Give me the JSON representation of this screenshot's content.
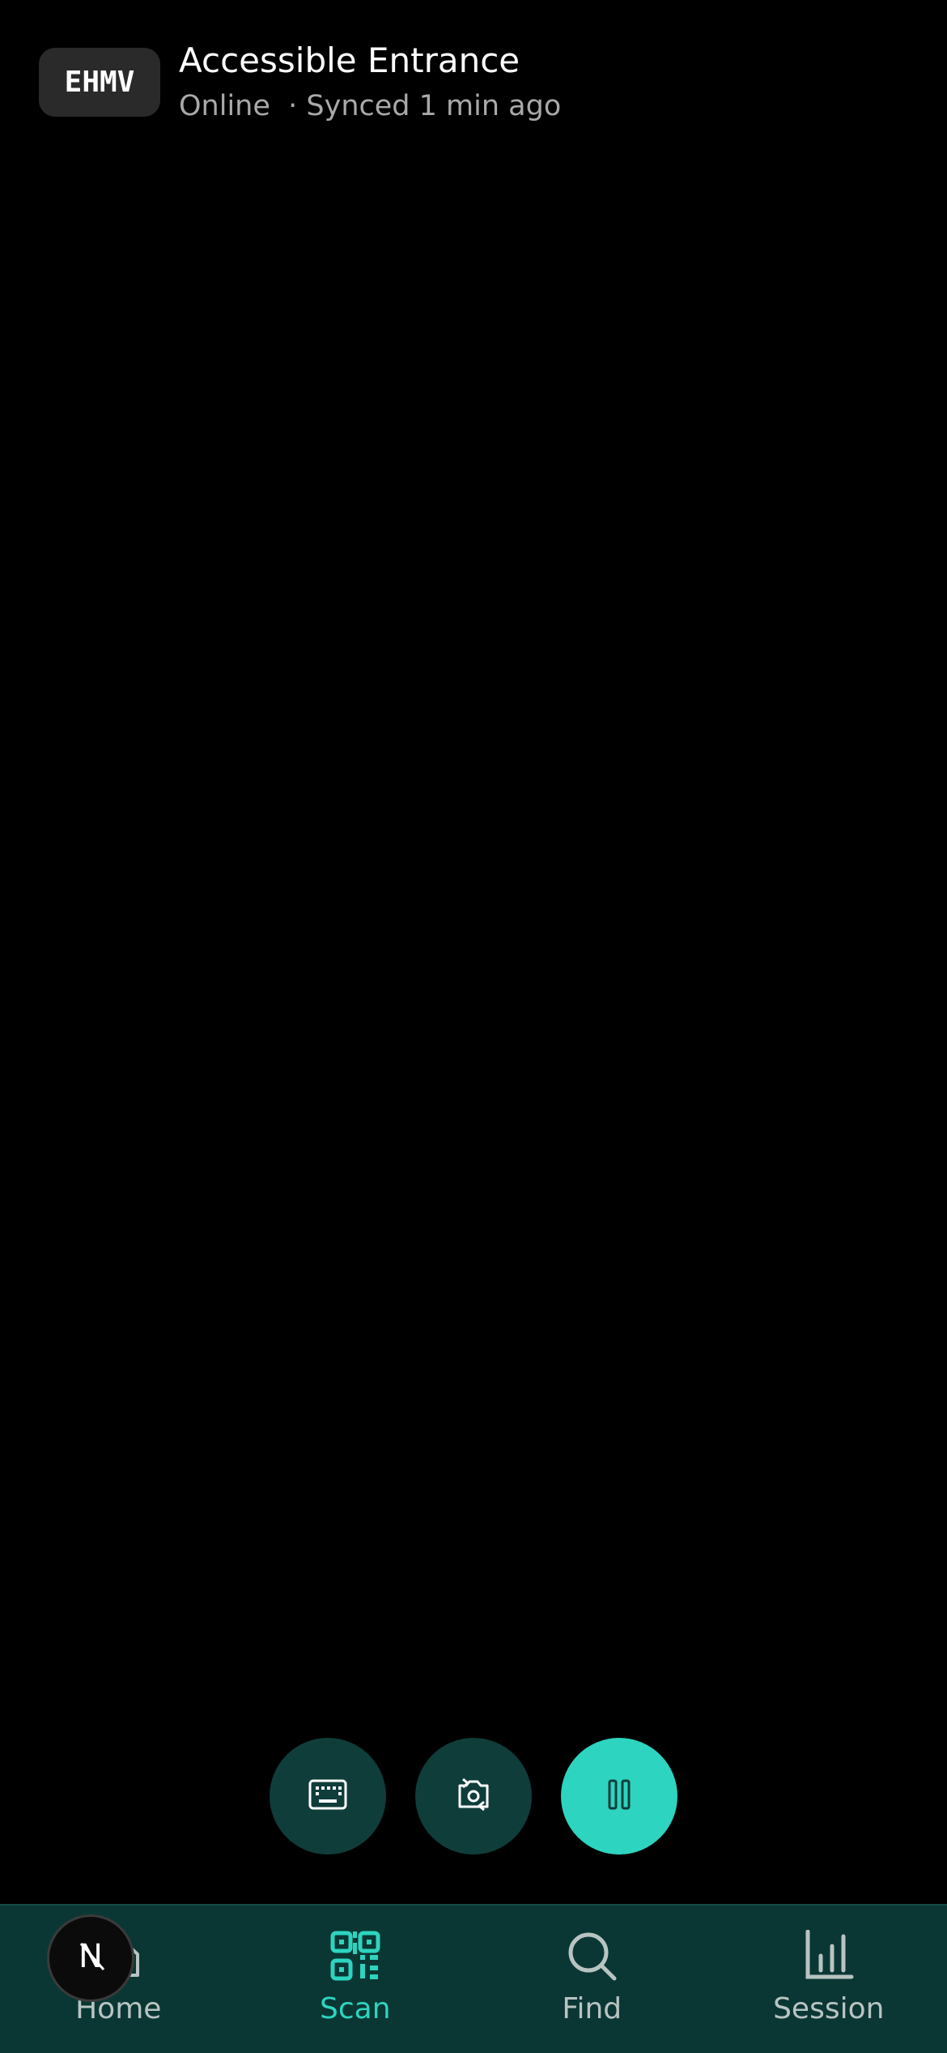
{
  "header": {
    "badge": "EHMV",
    "title": "Accessible Entrance",
    "status": "Online",
    "sync": "  · Synced 1 min ago"
  },
  "controls": {
    "keyboard_icon": "keyboard-icon",
    "switch_camera_icon": "switch-camera-icon",
    "pause_icon": "pause-icon"
  },
  "nav": {
    "items": [
      {
        "label": "Home",
        "icon": "home-icon"
      },
      {
        "label": "Scan",
        "icon": "qr-code-icon",
        "active": true
      },
      {
        "label": "Find",
        "icon": "search-icon"
      },
      {
        "label": "Session",
        "icon": "bar-chart-icon"
      }
    ]
  },
  "dev_badge": {
    "letter": "N"
  },
  "colors": {
    "accent": "#2dd4bf",
    "nav_bg": "#0a3734",
    "control_bg": "#0f3d3a",
    "background": "#000000"
  }
}
